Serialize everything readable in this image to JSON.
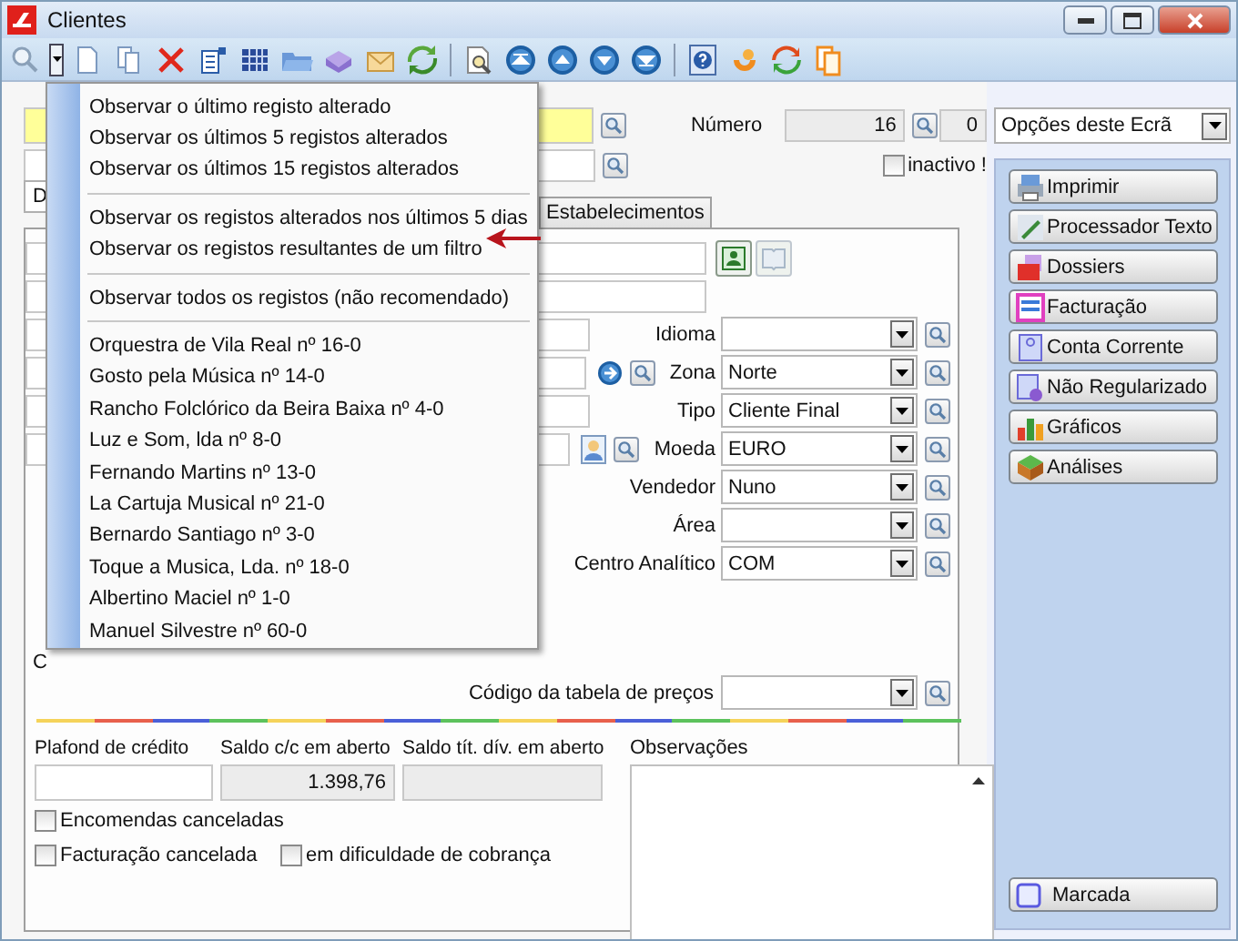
{
  "window": {
    "title": "Clientes"
  },
  "menu": {
    "groups": [
      [
        "Observar o último registo alterado",
        "Observar os últimos 5 registos alterados",
        "Observar os últimos 15 registos alterados"
      ],
      [
        "Observar os registos alterados nos últimos 5 dias",
        "Observar os registos resultantes de um filtro"
      ],
      [
        "Observar todos os registos (não recomendado)"
      ],
      [
        "Orquestra de Vila Real nº 16-0",
        "Gosto pela Música nº 14-0",
        "Rancho Folclórico da Beira Baixa nº 4-0",
        "Luz e Som, lda nº 8-0",
        "Fernando Martins nº 13-0",
        "La Cartuja Musical nº 21-0",
        "Bernardo Santiago nº 3-0",
        "Toque a Musica, Lda. nº 18-0",
        "Albertino Maciel nº 1-0",
        "Manuel Silvestre nº 60-0"
      ]
    ]
  },
  "header": {
    "number_label": "Número",
    "number": "16",
    "number_suffix": "0",
    "inactive": {
      "label": "inactivo !",
      "checked": false
    }
  },
  "tabs": [
    {
      "label": "D",
      "selected": true
    },
    {
      "label": "Estabelecimentos",
      "selected": false
    }
  ],
  "fields": [
    {
      "label": "Idioma"
    },
    {
      "label": "Zona",
      "value": "Norte"
    },
    {
      "label": "Tipo",
      "value": "Cliente Final"
    },
    {
      "label": "Moeda",
      "value": "EURO"
    },
    {
      "label": "Vendedor",
      "value": "Nuno"
    },
    {
      "label": "Área"
    },
    {
      "label": "Centro Analítico",
      "value": "COM"
    }
  ],
  "hidden_label": "C",
  "price_table": {
    "label": "Código da tabela de preços"
  },
  "balances": [
    {
      "label": "Plafond de crédito",
      "readonly": false
    },
    {
      "label": "Saldo c/c em aberto",
      "value": "1.398,76",
      "readonly": true
    },
    {
      "label": "Saldo tít. dív. em aberto",
      "readonly": true
    }
  ],
  "notes": {
    "label": "Observações"
  },
  "checkboxes": [
    {
      "label": "Encomendas canceladas",
      "checked": false
    },
    {
      "label": "Facturação cancelada",
      "checked": false
    },
    {
      "label": "em dificuldade de cobrança",
      "checked": false
    }
  ],
  "side": {
    "select": "Opções deste Ecrã",
    "buttons": [
      "Imprimir",
      "Processador Texto",
      "Dossiers",
      "Facturação",
      "Conta Corrente",
      "Não Regularizado",
      "Gráficos",
      "Análises"
    ],
    "marked": "Marcada"
  }
}
